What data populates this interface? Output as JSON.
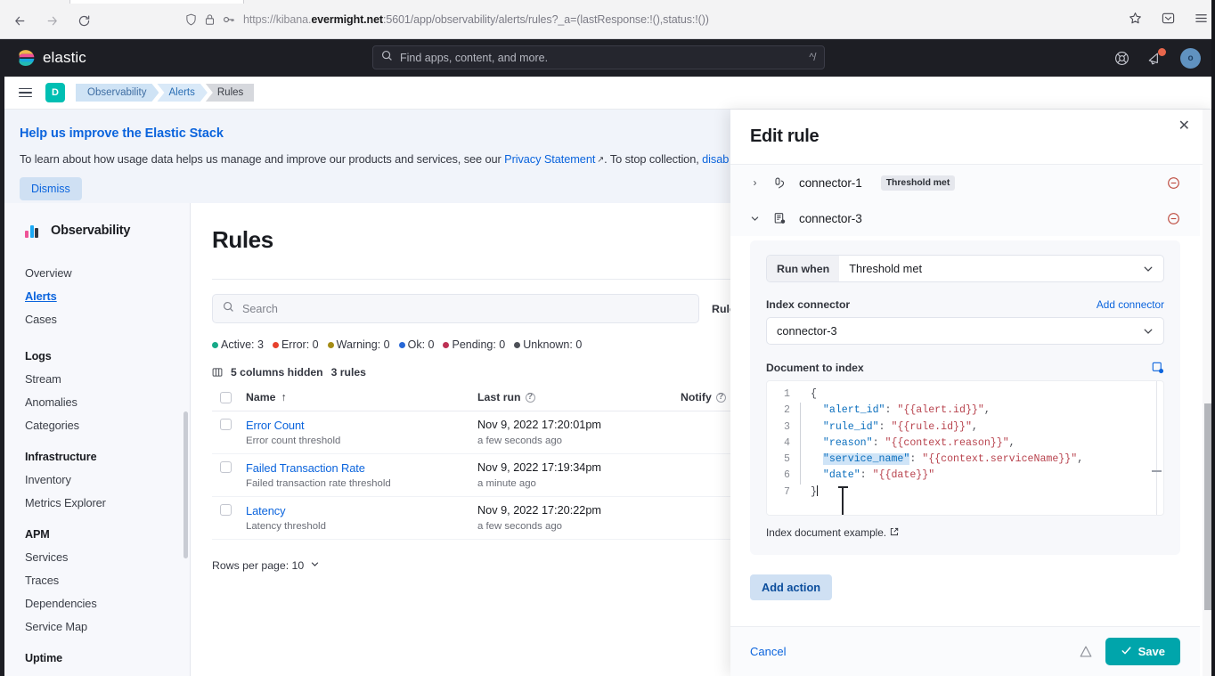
{
  "browser": {
    "back_icon": "back-arrow",
    "forward_icon": "forward-arrow",
    "reload_icon": "reload",
    "url_prefix": "https://kibana.",
    "url_host_strong": "evermight.net",
    "url_rest": ":5601/app/observability/alerts/rules?_a=(lastResponse:!(),status:!())",
    "bookmark_icon": "star-icon",
    "pocket_icon": "pocket-icon",
    "menu_icon": "hamburger-menu-icon"
  },
  "topnav": {
    "brand": "elastic",
    "search_placeholder": "Find apps, content, and more.",
    "search_shortcut": "^/",
    "help_icon": "help-lifebuoy-icon",
    "news_icon": "announcement-icon",
    "avatar_initial": "o"
  },
  "breadcrumb": {
    "space_initial": "D",
    "items": [
      {
        "label": "Observability"
      },
      {
        "label": "Alerts"
      },
      {
        "label": "Rules"
      }
    ]
  },
  "banner": {
    "title": "Help us improve the Elastic Stack",
    "body_before": "To learn about how usage data helps us manage and improve our products and services, see our ",
    "link_text": "Privacy Statement",
    "body_middle": ". To stop collection, ",
    "tail_text": "disab",
    "dismiss_label": "Dismiss"
  },
  "sidebar": {
    "app_title": "Observability",
    "top_links": [
      {
        "label": "Overview",
        "active": false
      },
      {
        "label": "Alerts",
        "active": true
      },
      {
        "label": "Cases",
        "active": false
      }
    ],
    "groups": [
      {
        "title": "Logs",
        "items": [
          "Stream",
          "Anomalies",
          "Categories"
        ]
      },
      {
        "title": "Infrastructure",
        "items": [
          "Inventory",
          "Metrics Explorer"
        ]
      },
      {
        "title": "APM",
        "items": [
          "Services",
          "Traces",
          "Dependencies",
          "Service Map"
        ]
      }
    ],
    "last_title": "Uptime"
  },
  "main": {
    "page_title": "Rules",
    "search_placeholder": "Search",
    "rule_status_label": "Rule s",
    "status_counts": [
      {
        "label": "Active: 3",
        "color": "#17a988"
      },
      {
        "label": "Error: 0",
        "color": "#e7402c"
      },
      {
        "label": "Warning: 0",
        "color": "#a48c16"
      },
      {
        "label": "Ok: 0",
        "color": "#2767d6"
      },
      {
        "label": "Pending: 0",
        "color": "#bd3154"
      },
      {
        "label": "Unknown: 0",
        "color": "#4d5057"
      }
    ],
    "columns_hidden": "5 columns hidden",
    "rules_count": "3 rules",
    "table": {
      "columns": [
        "Name",
        "Last run",
        "Notify"
      ],
      "sort_indicator": "↑",
      "rows": [
        {
          "name": "Error Count",
          "description": "Error count threshold",
          "last_run": "Nov 9, 2022 17:20:01pm",
          "last_run_rel": "a few seconds ago"
        },
        {
          "name": "Failed Transaction Rate",
          "description": "Failed transaction rate threshold",
          "last_run": "Nov 9, 2022 17:19:34pm",
          "last_run_rel": "a minute ago"
        },
        {
          "name": "Latency",
          "description": "Latency threshold",
          "last_run": "Nov 9, 2022 17:20:22pm",
          "last_run_rel": "a few seconds ago"
        }
      ]
    },
    "rows_per_page": "Rows per page: 10"
  },
  "flyout": {
    "title": "Edit rule",
    "close_icon": "close-icon",
    "connectors": [
      {
        "name": "connector-1",
        "icon": "slack-icon",
        "badge": "Threshold met",
        "expanded": false,
        "caret": "›"
      },
      {
        "name": "connector-3",
        "icon": "index-document-icon",
        "badge": "",
        "expanded": true,
        "caret": "⌄"
      }
    ],
    "run_when_label": "Run when",
    "run_when_value": "Threshold met",
    "index_connector_label": "Index connector",
    "add_connector_link": "Add connector",
    "index_connector_value": "connector-3",
    "document_label": "Document to index",
    "expand_icon": "expand-editor-icon",
    "code_lines": [
      {
        "n": "1",
        "tokens": [
          {
            "t": "{",
            "c": "p"
          }
        ]
      },
      {
        "n": "2",
        "tokens": [
          {
            "t": "  \"alert_id\"",
            "c": "k"
          },
          {
            "t": ": ",
            "c": "p"
          },
          {
            "t": "\"{{alert.id}}\"",
            "c": "v"
          },
          {
            "t": ",",
            "c": "p"
          }
        ]
      },
      {
        "n": "3",
        "tokens": [
          {
            "t": "  \"rule_id\"",
            "c": "k"
          },
          {
            "t": ": ",
            "c": "p"
          },
          {
            "t": "\"{{rule.id}}\"",
            "c": "v"
          },
          {
            "t": ",",
            "c": "p"
          }
        ]
      },
      {
        "n": "4",
        "tokens": [
          {
            "t": "  \"reason\"",
            "c": "k"
          },
          {
            "t": ": ",
            "c": "p"
          },
          {
            "t": "\"{{context.reason}}\"",
            "c": "v"
          },
          {
            "t": ",",
            "c": "p"
          }
        ]
      },
      {
        "n": "5",
        "tokens": [
          {
            "t": "  ",
            "c": "p"
          },
          {
            "t": "\"service_name\"",
            "c": "k-sel"
          },
          {
            "t": ": ",
            "c": "p"
          },
          {
            "t": "\"{{context.serviceName}}\"",
            "c": "v"
          },
          {
            "t": ",",
            "c": "p"
          }
        ]
      },
      {
        "n": "6",
        "tokens": [
          {
            "t": "  \"date\"",
            "c": "k"
          },
          {
            "t": ": ",
            "c": "p"
          },
          {
            "t": "\"{{date}}\"",
            "c": "v"
          }
        ]
      },
      {
        "n": "7",
        "tokens": [
          {
            "t": "}",
            "c": "p"
          }
        ]
      }
    ],
    "example_link": "Index document example.",
    "add_action_label": "Add action",
    "cancel_label": "Cancel",
    "save_label": "Save",
    "warning_icon": "warning-triangle-icon"
  },
  "colors": {
    "elastic_dark": "#1d1e24",
    "accent_blue": "#0b64dd",
    "teal": "#00a5ab",
    "space_teal": "#00bfb3",
    "danger": "#bd4a3e"
  }
}
